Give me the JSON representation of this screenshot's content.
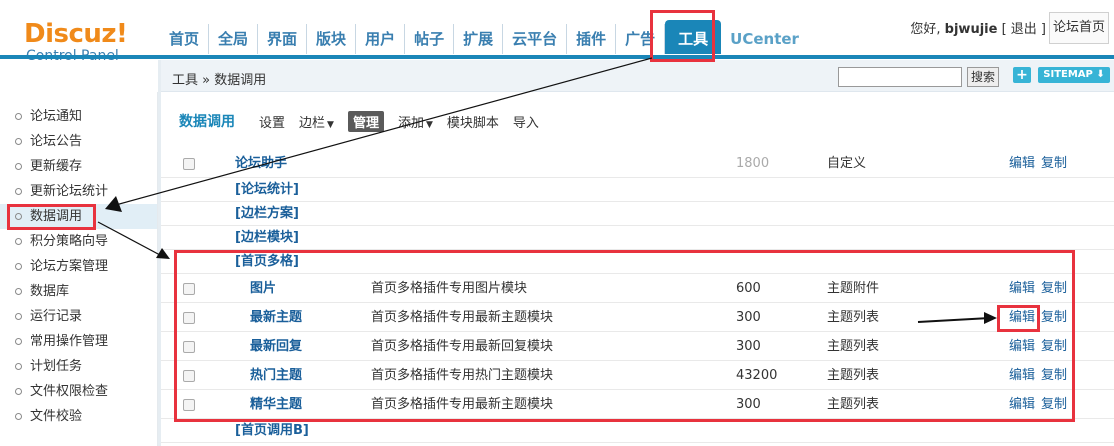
{
  "logo": {
    "main": "Discuz!",
    "sub": "Control Panel"
  },
  "nav": [
    {
      "label": "首页"
    },
    {
      "label": "全局"
    },
    {
      "label": "界面"
    },
    {
      "label": "版块"
    },
    {
      "label": "用户"
    },
    {
      "label": "帖子"
    },
    {
      "label": "扩展"
    },
    {
      "label": "云平台"
    },
    {
      "label": "插件"
    },
    {
      "label": "广告"
    },
    {
      "label": "工具",
      "active": true
    },
    {
      "label": "UCenter"
    }
  ],
  "user": {
    "greeting": "您好,",
    "name": "bjwujie",
    "logout": "[ 退出 ]",
    "home_button": "论坛首页"
  },
  "breadcrumb": "工具 » 数据调用",
  "search": {
    "placeholder": "",
    "button": "搜索"
  },
  "plus_label": "+",
  "sitemap_label": "SITEMAP ⬇",
  "sidebar": [
    {
      "label": "论坛通知"
    },
    {
      "label": "论坛公告"
    },
    {
      "label": "更新缓存"
    },
    {
      "label": "更新论坛统计"
    },
    {
      "label": "数据调用",
      "active": true
    },
    {
      "label": "积分策略向导"
    },
    {
      "label": "论坛方案管理"
    },
    {
      "label": "数据库"
    },
    {
      "label": "运行记录"
    },
    {
      "label": "常用操作管理"
    },
    {
      "label": "计划任务"
    },
    {
      "label": "文件权限检查"
    },
    {
      "label": "文件校验"
    }
  ],
  "subnav": {
    "title": "数据调用",
    "links": [
      {
        "label": "设置"
      },
      {
        "label": "边栏",
        "caret": true
      },
      {
        "label": "管理",
        "selected": true
      },
      {
        "label": "添加",
        "caret": true
      },
      {
        "label": "模块脚本"
      },
      {
        "label": "导入"
      }
    ]
  },
  "ops": {
    "edit": "编辑",
    "copy": "复制"
  },
  "top_row": {
    "name": "论坛助手",
    "num": "1800",
    "type": "自定义"
  },
  "categories_before": [
    "[论坛统计]",
    "[边栏方案]",
    "[边栏模块]"
  ],
  "group_title": "[首页多格]",
  "group_rows": [
    {
      "name": "图片",
      "desc": "首页多格插件专用图片模块",
      "num": "600",
      "type": "主题附件"
    },
    {
      "name": "最新主题",
      "desc": "首页多格插件专用最新主题模块",
      "num": "300",
      "type": "主题列表"
    },
    {
      "name": "最新回复",
      "desc": "首页多格插件专用最新回复模块",
      "num": "300",
      "type": "主题列表"
    },
    {
      "name": "热门主题",
      "desc": "首页多格插件专用热门主题模块",
      "num": "43200",
      "type": "主题列表"
    },
    {
      "name": "精华主题",
      "desc": "首页多格插件专用最新主题模块",
      "num": "300",
      "type": "主题列表"
    }
  ],
  "last_category": "[首页调用B]",
  "colors": {
    "accent": "#1a86b8",
    "highlight": "#e8323e",
    "logo": "#f08a1a"
  }
}
